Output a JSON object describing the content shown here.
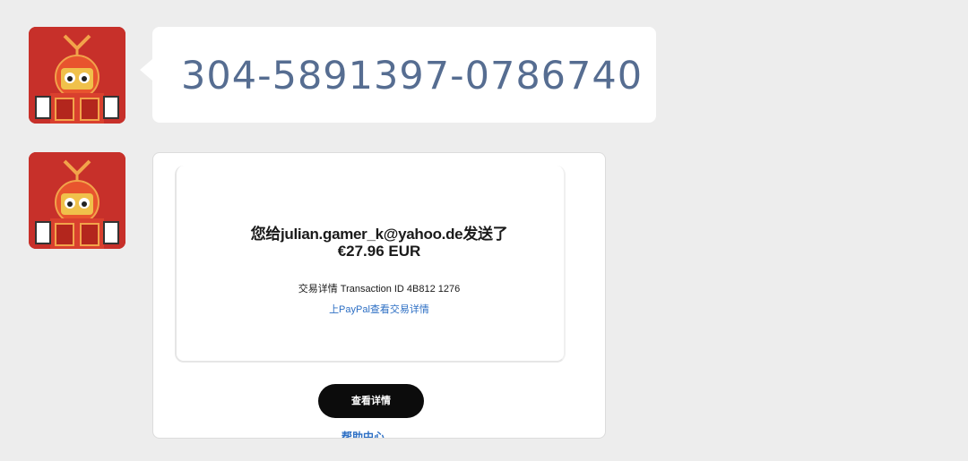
{
  "messages": [
    {
      "type": "text",
      "text": "304-5891397-0786740"
    },
    {
      "type": "image",
      "image": {
        "payment_line": "您给julian.gamer_k@yahoo.de发送了",
        "amount": "€27.96 EUR",
        "details_line": "交易详情 Transaction ID  4B812 1276",
        "link_line": "上PayPal查看交易详情",
        "button_label": "查看详情",
        "bottom_link": "帮助中心"
      }
    }
  ],
  "colors": {
    "background": "#ededed",
    "bubble": "#ffffff",
    "number_text": "#566d91",
    "link": "#2d6fc4"
  },
  "icons": {
    "avatar": "red-robot-avatar"
  }
}
